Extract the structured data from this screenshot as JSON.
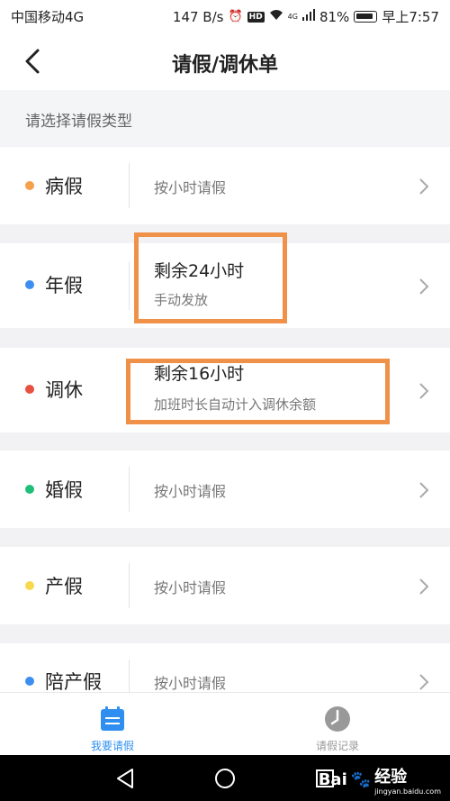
{
  "status_bar": {
    "carrier": "中国移动4G",
    "speed": "147 B/s",
    "hd": "HD",
    "signal": "4G",
    "battery": "81%",
    "time": "早上7:57"
  },
  "nav": {
    "title": "请假/调休单"
  },
  "section": {
    "header": "请选择请假类型"
  },
  "leave_types": [
    {
      "name": "病假",
      "dot_color": "#f5a04a",
      "desc": "按小时请假"
    },
    {
      "name": "年假",
      "dot_color": "#3d8ef0",
      "desc_main": "剩余24小时",
      "desc_sub": "手动发放"
    },
    {
      "name": "调休",
      "dot_color": "#e8503f",
      "desc_main": "剩余16小时",
      "desc_sub": "加班时长自动计入调休余额"
    },
    {
      "name": "婚假",
      "dot_color": "#1fbf7a",
      "desc": "按小时请假"
    },
    {
      "name": "产假",
      "dot_color": "#f7d94c",
      "desc": "按小时请假"
    },
    {
      "name": "陪产假",
      "dot_color": "#3d8ef0",
      "desc": "按小时请假"
    }
  ],
  "tabs": [
    {
      "label": "我要请假",
      "color": "#2f8ff0"
    },
    {
      "label": "请假记录",
      "color": "#999999"
    }
  ],
  "watermark": {
    "brand": "Bai",
    "brand2": "经验",
    "url": "jingyan.baidu.com"
  },
  "colors": {
    "highlight": "#f0914a",
    "accent": "#2f8ff0"
  }
}
